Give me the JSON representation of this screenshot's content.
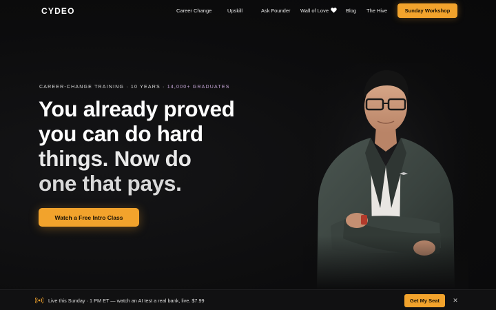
{
  "brand": {
    "logo": "CYDEO"
  },
  "nav": {
    "links": [
      "Career Change",
      "Upskill",
      "Ask Founder",
      "Wall of Love",
      "Blog",
      "The Hive"
    ],
    "heart_icon": "heart-icon",
    "cta": "Sunday Workshop"
  },
  "hero": {
    "eyebrow_main": "CAREER-CHANGE TRAINING · 10 YEARS · ",
    "eyebrow_accent": "14,000+ GRADUATES",
    "headline": [
      "You already proved",
      "you can do hard",
      "things. Now do",
      "one that pays."
    ],
    "cta": "Watch a Free Intro Class"
  },
  "banner": {
    "icon": "broadcast-icon",
    "text": "Live this Sunday · 1 PM ET — watch an AI test a real bank, live. $7.99",
    "cta": "Get My Seat",
    "close": "✕"
  },
  "colors": {
    "accent": "#f2a32c",
    "background": "#0d0d0e",
    "eyebrow_accent": "#c5a6d6"
  }
}
